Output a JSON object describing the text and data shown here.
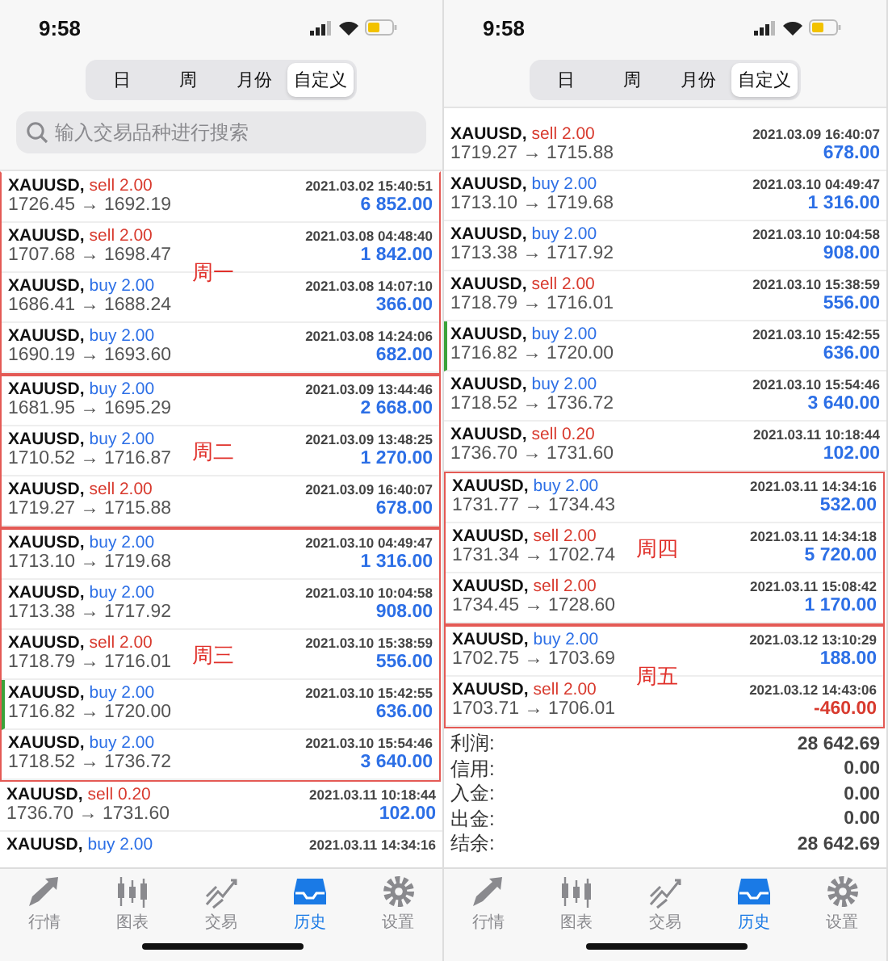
{
  "screens": [
    {
      "time": "9:58",
      "segments": [
        {
          "label": "日",
          "selected": false
        },
        {
          "label": "周",
          "selected": false
        },
        {
          "label": "月份",
          "selected": false
        },
        {
          "label": "自定义",
          "selected": true
        }
      ],
      "search": {
        "placeholder": "输入交易品种进行搜索"
      },
      "groups": [
        {
          "label": "周一",
          "rows": [
            {
              "symbol": "XAUUSD,",
              "order": "sell 2.00",
              "kind": "sell",
              "time": "2021.03.02 15:40:51",
              "prices": "1726.45 → 1692.19",
              "profit": "6 852.00",
              "color": "#2c6fe6",
              "marked": false
            },
            {
              "symbol": "XAUUSD,",
              "order": "sell 2.00",
              "kind": "sell",
              "time": "2021.03.08 04:48:40",
              "prices": "1707.68 → 1698.47",
              "profit": "1 842.00",
              "color": "#2c6fe6",
              "marked": false
            },
            {
              "symbol": "XAUUSD,",
              "order": "buy 2.00",
              "kind": "buy",
              "time": "2021.03.08 14:07:10",
              "prices": "1686.41 → 1688.24",
              "profit": "366.00",
              "color": "#2c6fe6",
              "marked": false
            },
            {
              "symbol": "XAUUSD,",
              "order": "buy 2.00",
              "kind": "buy",
              "time": "2021.03.08 14:24:06",
              "prices": "1690.19 → 1693.60",
              "profit": "682.00",
              "color": "#2c6fe6",
              "marked": false
            }
          ]
        },
        {
          "label": "周二",
          "rows": [
            {
              "symbol": "XAUUSD,",
              "order": "buy 2.00",
              "kind": "buy",
              "time": "2021.03.09 13:44:46",
              "prices": "1681.95 → 1695.29",
              "profit": "2 668.00",
              "color": "#2c6fe6",
              "marked": false
            },
            {
              "symbol": "XAUUSD,",
              "order": "buy 2.00",
              "kind": "buy",
              "time": "2021.03.09 13:48:25",
              "prices": "1710.52 → 1716.87",
              "profit": "1 270.00",
              "color": "#2c6fe6",
              "marked": false
            },
            {
              "symbol": "XAUUSD,",
              "order": "sell 2.00",
              "kind": "sell",
              "time": "2021.03.09 16:40:07",
              "prices": "1719.27 → 1715.88",
              "profit": "678.00",
              "color": "#2c6fe6",
              "marked": false
            }
          ]
        },
        {
          "label": "周三",
          "rows": [
            {
              "symbol": "XAUUSD,",
              "order": "buy 2.00",
              "kind": "buy",
              "time": "2021.03.10 04:49:47",
              "prices": "1713.10 → 1719.68",
              "profit": "1 316.00",
              "color": "#2c6fe6",
              "marked": false
            },
            {
              "symbol": "XAUUSD,",
              "order": "buy 2.00",
              "kind": "buy",
              "time": "2021.03.10 10:04:58",
              "prices": "1713.38 → 1717.92",
              "profit": "908.00",
              "color": "#2c6fe6",
              "marked": false
            },
            {
              "symbol": "XAUUSD,",
              "order": "sell 2.00",
              "kind": "sell",
              "time": "2021.03.10 15:38:59",
              "prices": "1718.79 → 1716.01",
              "profit": "556.00",
              "color": "#2c6fe6",
              "marked": false
            },
            {
              "symbol": "XAUUSD,",
              "order": "buy 2.00",
              "kind": "buy",
              "time": "2021.03.10 15:42:55",
              "prices": "1716.82 → 1720.00",
              "profit": "636.00",
              "color": "#2c6fe6",
              "marked": true
            },
            {
              "symbol": "XAUUSD,",
              "order": "buy 2.00",
              "kind": "buy",
              "time": "2021.03.10 15:54:46",
              "prices": "1718.52 → 1736.72",
              "profit": "3 640.00",
              "color": "#2c6fe6",
              "marked": false
            }
          ]
        },
        {
          "rows": [
            {
              "symbol": "XAUUSD,",
              "order": "sell 0.20",
              "kind": "sell",
              "time": "2021.03.11 10:18:44",
              "prices": "1736.70 → 1731.60",
              "profit": "102.00",
              "color": "#2c6fe6",
              "marked": false
            },
            {
              "symbol": "XAUUSD,",
              "order": "buy 2.00",
              "kind": "buy",
              "time": "2021.03.11 14:34:16",
              "marked": false
            }
          ]
        }
      ],
      "tabs": [
        {
          "label": "行情",
          "selected": false
        },
        {
          "label": "图表",
          "selected": false
        },
        {
          "label": "交易",
          "selected": false
        },
        {
          "label": "历史",
          "selected": true
        },
        {
          "label": "设置",
          "selected": false
        }
      ]
    },
    {
      "time": "9:58",
      "segments": [
        {
          "label": "日",
          "selected": false
        },
        {
          "label": "周",
          "selected": false
        },
        {
          "label": "月份",
          "selected": false
        },
        {
          "label": "自定义",
          "selected": true
        }
      ],
      "groups": [
        {
          "rows": [
            {
              "symbol": "XAUUSD,",
              "order": "sell 2.00",
              "kind": "sell",
              "time": "2021.03.09 16:40:07",
              "prices": "1719.27 → 1715.88",
              "profit": "678.00",
              "color": "#2c6fe6",
              "marked": false
            },
            {
              "symbol": "XAUUSD,",
              "order": "buy 2.00",
              "kind": "buy",
              "time": "2021.03.10 04:49:47",
              "prices": "1713.10 → 1719.68",
              "profit": "1 316.00",
              "color": "#2c6fe6",
              "marked": false
            },
            {
              "symbol": "XAUUSD,",
              "order": "buy 2.00",
              "kind": "buy",
              "time": "2021.03.10 10:04:58",
              "prices": "1713.38 → 1717.92",
              "profit": "908.00",
              "color": "#2c6fe6",
              "marked": false
            },
            {
              "symbol": "XAUUSD,",
              "order": "sell 2.00",
              "kind": "sell",
              "time": "2021.03.10 15:38:59",
              "prices": "1718.79 → 1716.01",
              "profit": "556.00",
              "color": "#2c6fe6",
              "marked": false
            },
            {
              "symbol": "XAUUSD,",
              "order": "buy 2.00",
              "kind": "buy",
              "time": "2021.03.10 15:42:55",
              "prices": "1716.82 → 1720.00",
              "profit": "636.00",
              "color": "#2c6fe6",
              "marked": true
            },
            {
              "symbol": "XAUUSD,",
              "order": "buy 2.00",
              "kind": "buy",
              "time": "2021.03.10 15:54:46",
              "prices": "1718.52 → 1736.72",
              "profit": "3 640.00",
              "color": "#2c6fe6",
              "marked": false
            },
            {
              "symbol": "XAUUSD,",
              "order": "sell 0.20",
              "kind": "sell",
              "time": "2021.03.11 10:18:44",
              "prices": "1736.70 → 1731.60",
              "profit": "102.00",
              "color": "#2c6fe6",
              "marked": false
            }
          ]
        },
        {
          "label": "周四",
          "rows": [
            {
              "symbol": "XAUUSD,",
              "order": "buy 2.00",
              "kind": "buy",
              "time": "2021.03.11 14:34:16",
              "prices": "1731.77 → 1734.43",
              "profit": "532.00",
              "color": "#2c6fe6",
              "marked": false
            },
            {
              "symbol": "XAUUSD,",
              "order": "sell 2.00",
              "kind": "sell",
              "time": "2021.03.11 14:34:18",
              "prices": "1731.34 → 1702.74",
              "profit": "5 720.00",
              "color": "#2c6fe6",
              "marked": false
            },
            {
              "symbol": "XAUUSD,",
              "order": "sell 2.00",
              "kind": "sell",
              "time": "2021.03.11 15:08:42",
              "prices": "1734.45 → 1728.60",
              "profit": "1 170.00",
              "color": "#2c6fe6",
              "marked": false
            }
          ]
        },
        {
          "label": "周五",
          "rows": [
            {
              "symbol": "XAUUSD,",
              "order": "buy 2.00",
              "kind": "buy",
              "time": "2021.03.12 13:10:29",
              "prices": "1702.75 → 1703.69",
              "profit": "188.00",
              "color": "#2c6fe6",
              "marked": false
            },
            {
              "symbol": "XAUUSD,",
              "order": "sell 2.00",
              "kind": "sell",
              "time": "2021.03.12 14:43:06",
              "prices": "1703.71 → 1706.01",
              "profit": "-460.00",
              "color": "#d83a2e",
              "marked": false
            }
          ]
        }
      ],
      "summary": [
        {
          "label": "利润:",
          "value": "28 642.69"
        },
        {
          "label": "信用:",
          "value": "0.00"
        },
        {
          "label": "入金:",
          "value": "0.00"
        },
        {
          "label": "出金:",
          "value": "0.00"
        },
        {
          "label": "结余:",
          "value": "28 642.69"
        }
      ],
      "tabs": [
        {
          "label": "行情",
          "selected": false
        },
        {
          "label": "图表",
          "selected": false
        },
        {
          "label": "交易",
          "selected": false
        },
        {
          "label": "历史",
          "selected": true
        },
        {
          "label": "设置",
          "selected": false
        }
      ]
    }
  ]
}
